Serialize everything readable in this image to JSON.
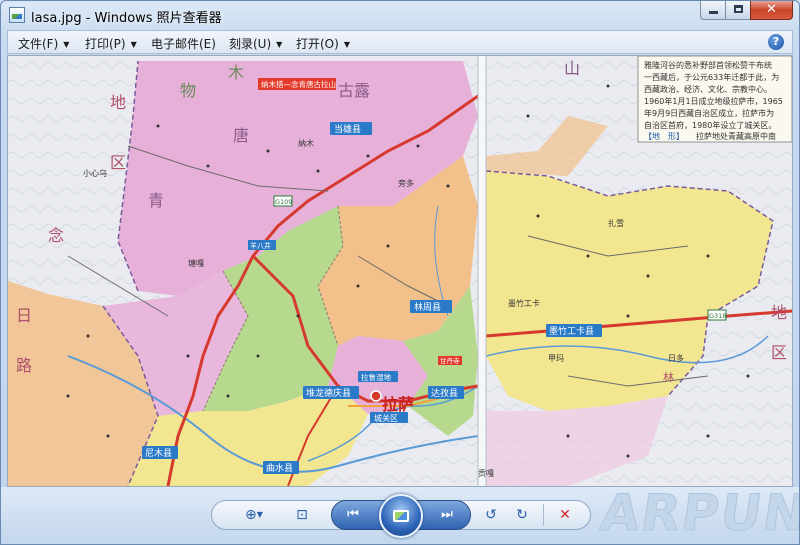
{
  "window": {
    "title": "lasa.jpg - Windows 照片查看器"
  },
  "menu": {
    "items": [
      {
        "label": "文件(F)",
        "has_caret": true
      },
      {
        "label": "打印(P)",
        "has_caret": true
      },
      {
        "label": "电子邮件(E)",
        "has_caret": false
      },
      {
        "label": "刻录(U)",
        "has_caret": true
      },
      {
        "label": "打开(O)",
        "has_caret": true
      }
    ],
    "help_label": "?",
    "caret": "▼"
  },
  "map": {
    "text_box": {
      "lines": [
        "雅隆河谷的悉补野部首领松赞干布统",
        "一西藏后，于公元633年迁都于此，为",
        "西藏政治、经济、文化、宗教中心。",
        "1960年1月1日成立地级拉萨市，1965",
        "年9月9日西藏自治区成立，拉萨市为",
        "自治区首府，1980年设立了城关区。"
      ],
      "last_line_tag": "【地　形】",
      "last_line_text": "拉萨地处青藏高原中南"
    },
    "labels": {
      "lhasa": "拉萨",
      "chengguan": "城关区",
      "damxung": "当雄县",
      "linzhou": "林周县",
      "maizhokunggar": "墨竹工卡县",
      "nyemo": "尼木县",
      "quxu": "曲水县",
      "doilungdeqen": "堆龙德庆县",
      "dagze": "达孜县",
      "gulu": "古露",
      "tang": "唐",
      "qing": "青",
      "shan": "山",
      "mu": "木",
      "wu": "物",
      "di_left": "地",
      "qu_left": "区",
      "nian": "念",
      "ri": "日",
      "lu": "路",
      "di_right": "地",
      "qu_right": "区",
      "xinhai": "小心乌",
      "yangbajing": "羊八井",
      "ganden": "甘丹寺",
      "red_banner": "纳木措—念青唐古拉山",
      "blue_road": "墨竹工卡",
      "lalu": "拉鲁湿地",
      "jiama": "甲玛",
      "rigong": "日多",
      "lingbo": "林",
      "pongdo": "旁多",
      "zhaxue": "扎雪",
      "tangga": "塘嘎",
      "namu": "纳木",
      "gongbo": "贡嘎",
      "road_110": "G109",
      "road_318": "G318"
    }
  },
  "toolbar": {
    "zoom_label": "⊕",
    "fit_label": "⊡",
    "prev_label": "⏮",
    "next_label": "⏭",
    "rotate_ccw_label": "↺",
    "rotate_cw_label": "↻",
    "delete_label": "✕"
  },
  "watermark": {
    "text": "ARPUN"
  },
  "colors": {
    "lhasa_pink": "#e7b0d8",
    "yellow_region": "#f3e690",
    "green_region": "#b6d98e",
    "peach_region": "#f2c08a",
    "outside_region": "#e9ebf0",
    "border_dashed": "#7a5a9a",
    "red_road": "#d63a2e"
  }
}
